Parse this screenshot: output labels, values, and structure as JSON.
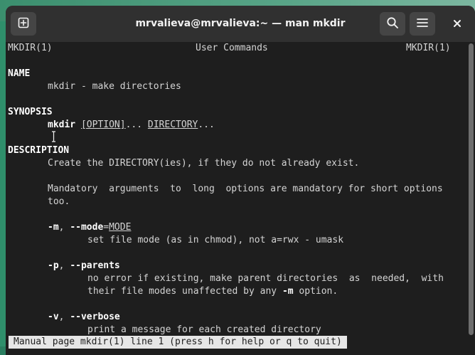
{
  "window": {
    "title": "mrvalieva@mrvalieva:~ — man mkdir"
  },
  "header_buttons": {
    "new_tab_icon": "plus-in-square-icon",
    "search_icon": "search-icon",
    "menu_icon": "hamburger-menu-icon",
    "close_icon": "close-icon"
  },
  "man": {
    "header_left": "MKDIR(1)",
    "header_center": "User Commands",
    "header_right": "MKDIR(1)",
    "name_heading": "NAME",
    "name_text": "mkdir - make directories",
    "synopsis_heading": "SYNOPSIS",
    "synopsis_cmd": "mkdir",
    "synopsis_option": "[OPTION]",
    "synopsis_dots1": "...",
    "synopsis_dir": "DIRECTORY",
    "synopsis_dots2": "...",
    "description_heading": "DESCRIPTION",
    "desc_line1": "Create the DIRECTORY(ies), if they do not already exist.",
    "desc_line2": "Mandatory  arguments  to  long  options are mandatory for short options",
    "desc_line3": "too.",
    "opt_m_short": "-m",
    "opt_m_sep": ", ",
    "opt_m_long": "--mode",
    "opt_m_eq": "=",
    "opt_m_arg": "MODE",
    "opt_m_desc": "set file mode (as in chmod), not a=rwx - umask",
    "opt_p_short": "-p",
    "opt_p_sep": ", ",
    "opt_p_long": "--parents",
    "opt_p_desc1": "no error if existing, make parent directories  as  needed,  with",
    "opt_p_desc2a": "their file modes unaffected by any ",
    "opt_p_desc2b": "-m",
    "opt_p_desc2c": " option.",
    "opt_v_short": "-v",
    "opt_v_sep": ", ",
    "opt_v_long": "--verbose",
    "opt_v_desc": "print a message for each created directory"
  },
  "status_bar": {
    "text": "Manual page mkdir(1) line 1 (press h for help or q to quit)"
  },
  "colors": {
    "terminal_bg": "#1e1e1e",
    "headerbar_bg": "#303030",
    "text": "#d4d4d4",
    "bold_text": "#ffffff",
    "status_bg": "#e6e6e6"
  }
}
